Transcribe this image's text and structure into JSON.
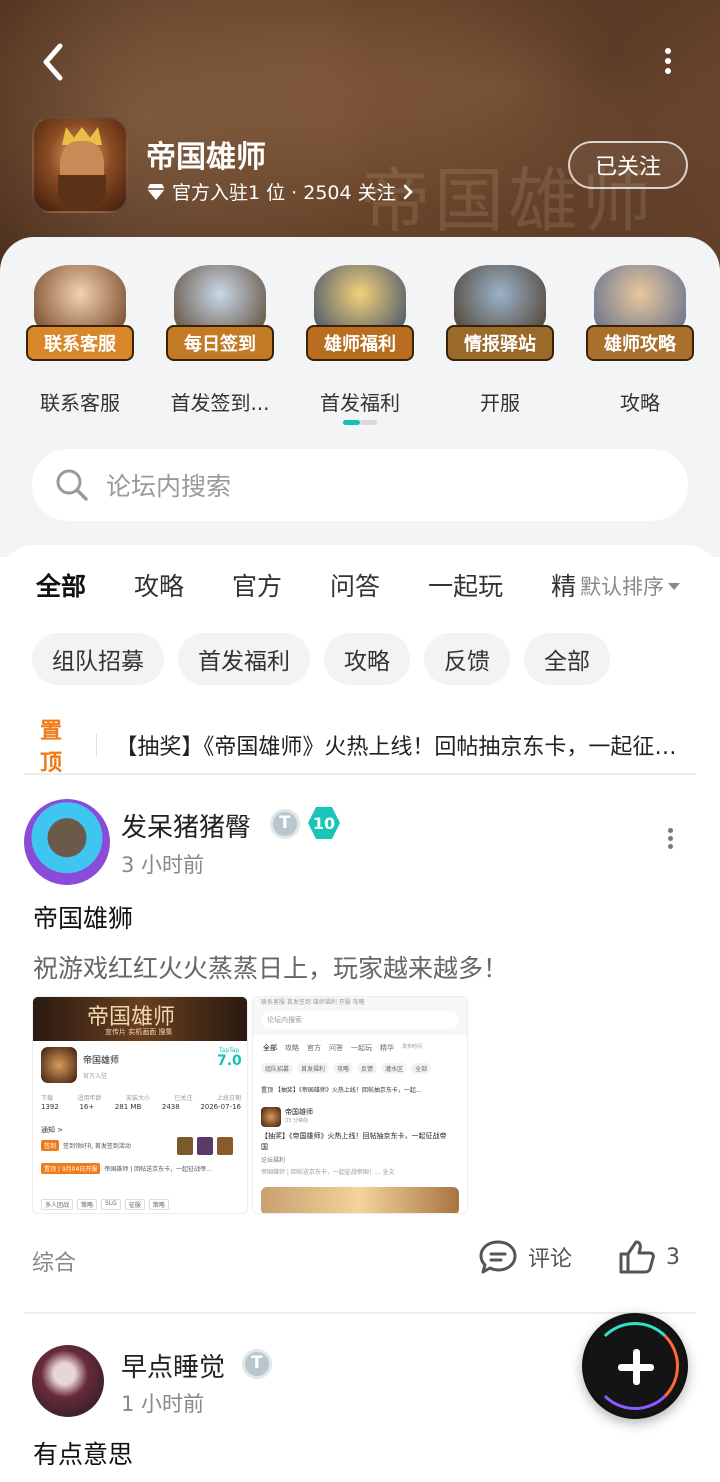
{
  "header": {
    "bg_watermark": "帝国雄师",
    "game_name": "帝国雄师",
    "meta": "官方入驻1 位 · 2504 关注",
    "follow_label": "已关注"
  },
  "shortcuts": [
    {
      "banner": "联系客服",
      "label": "联系客服",
      "color": "#d8882a",
      "icon": "customer-service-icon"
    },
    {
      "banner": "每日签到",
      "label": "首发签到...",
      "color": "#c27a24",
      "icon": "daily-checkin-icon"
    },
    {
      "banner": "雄师福利",
      "label": "首发福利",
      "color": "#b86d1f",
      "icon": "welfare-gift-icon"
    },
    {
      "banner": "情报驿站",
      "label": "开服",
      "color": "#9a6a2a",
      "icon": "intel-station-icon"
    },
    {
      "banner": "雄师攻略",
      "label": "攻略",
      "color": "#a8702a",
      "icon": "strategy-guide-icon"
    }
  ],
  "search": {
    "placeholder": "论坛内搜索"
  },
  "tabs": [
    "全部",
    "攻略",
    "官方",
    "问答",
    "一起玩",
    "精"
  ],
  "sort_label": "默认排序",
  "chips": [
    "组队招募",
    "首发福利",
    "攻略",
    "反馈",
    "全部"
  ],
  "pinned": {
    "tag": "置顶",
    "text": "【抽奖】《帝国雄师》火热上线！回帖抽京东卡，一起征战帝国！"
  },
  "post1": {
    "username": "发呆猪猪臀",
    "level": "10",
    "time": "3 小时前",
    "title": "帝国雄狮",
    "body": "祝游戏红红火火蒸蒸日上，玩家越来越多！",
    "footer_tag": "综合",
    "comment_label": "评论",
    "like_count": "3",
    "shot_left": {
      "banner": "帝国雄师",
      "subtabs": "宣传片   实机画面   搜集",
      "game": "帝国雄师",
      "official": "官方入驻",
      "score_brand": "TapTap",
      "score": "7.0",
      "stats_labels": [
        "下载",
        "适用年龄",
        "安装大小",
        "已关注",
        "上线日期"
      ],
      "stats_values": [
        "1392",
        "16+",
        "281 MB",
        "2438",
        "2026-07-16"
      ],
      "notice": "通知 >",
      "row1_tag": "签到",
      "row1": "签到领好礼 首发签到活动",
      "row2_tag": "置顶 | 9月04日开服",
      "row2": "帝国雄师 | 回帖送京东卡，一起征战帝...",
      "bottom_tabs": [
        "多人团战",
        "策略",
        "SLG",
        "征服",
        "策略"
      ]
    },
    "shot_right": {
      "top_tabs": "联系客服   首发签到   雄师福利   开服   攻略",
      "search": "论坛内搜索",
      "tabs": [
        "全部",
        "攻略",
        "官方",
        "问答",
        "一起玩",
        "精华",
        "发布时间"
      ],
      "chips": [
        "组队招募",
        "首发福利",
        "攻略",
        "反馈",
        "灌水区",
        "全部"
      ],
      "pin": "置顶  【抽奖】《帝国雄师》火热上线！回帖抽京东卡，一起...",
      "post_user": "帝国雄师",
      "post_time": "33 分钟前",
      "post_title": "【抽奖】《帝国雄师》火热上线！回帖抽京东卡，一起征战帝国",
      "post_tag": "论坛福利",
      "post_body": "帝国雄师 | 回帖送京东卡，一起征战帝国！... 全文"
    }
  },
  "post2": {
    "username": "早点睡觉",
    "time": "1 小时前",
    "title": "有点意思"
  }
}
